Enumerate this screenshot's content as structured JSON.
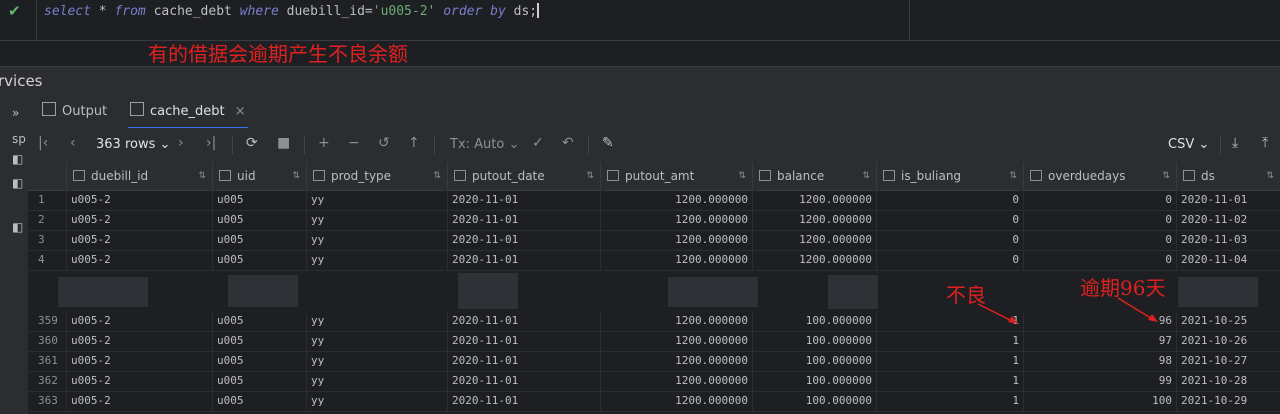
{
  "editor": {
    "sql": {
      "kw_select": "select",
      "star": " * ",
      "kw_from": "from",
      "table": " cache_debt ",
      "kw_where": "where",
      "cond": " duebill_id=",
      "val": "'u005-2'",
      "kw_order": " order by",
      "tail": " ds;"
    },
    "note": "有的借据会逾期产生不良余额"
  },
  "services": {
    "label": "rvices"
  },
  "left_strip": {
    "label": "sp"
  },
  "tabs": [
    {
      "label": "Output"
    },
    {
      "label": "cache_debt"
    }
  ],
  "toolbar": {
    "rows": "363 rows",
    "tx": "Tx: Auto",
    "export": "CSV"
  },
  "grid": {
    "columns": [
      "duebill_id",
      "uid",
      "prod_type",
      "putout_date",
      "putout_amt",
      "balance",
      "is_buliang",
      "overduedays",
      "ds"
    ],
    "top_rows": [
      {
        "n": "1",
        "duebill_id": "u005-2",
        "uid": "u005",
        "prod_type": "yy",
        "putout_date": "2020-11-01",
        "putout_amt": "1200.000000",
        "balance": "1200.000000",
        "is_buliang": "0",
        "overduedays": "0",
        "ds": "2020-11-01"
      },
      {
        "n": "2",
        "duebill_id": "u005-2",
        "uid": "u005",
        "prod_type": "yy",
        "putout_date": "2020-11-01",
        "putout_amt": "1200.000000",
        "balance": "1200.000000",
        "is_buliang": "0",
        "overduedays": "0",
        "ds": "2020-11-02"
      },
      {
        "n": "3",
        "duebill_id": "u005-2",
        "uid": "u005",
        "prod_type": "yy",
        "putout_date": "2020-11-01",
        "putout_amt": "1200.000000",
        "balance": "1200.000000",
        "is_buliang": "0",
        "overduedays": "0",
        "ds": "2020-11-03"
      },
      {
        "n": "4",
        "duebill_id": "u005-2",
        "uid": "u005",
        "prod_type": "yy",
        "putout_date": "2020-11-01",
        "putout_amt": "1200.000000",
        "balance": "1200.000000",
        "is_buliang": "0",
        "overduedays": "0",
        "ds": "2020-11-04"
      }
    ],
    "bottom_rows": [
      {
        "n": "359",
        "duebill_id": "u005-2",
        "uid": "u005",
        "prod_type": "yy",
        "putout_date": "2020-11-01",
        "putout_amt": "1200.000000",
        "balance": "100.000000",
        "is_buliang": "1",
        "overduedays": "96",
        "ds": "2021-10-25"
      },
      {
        "n": "360",
        "duebill_id": "u005-2",
        "uid": "u005",
        "prod_type": "yy",
        "putout_date": "2020-11-01",
        "putout_amt": "1200.000000",
        "balance": "100.000000",
        "is_buliang": "1",
        "overduedays": "97",
        "ds": "2021-10-26"
      },
      {
        "n": "361",
        "duebill_id": "u005-2",
        "uid": "u005",
        "prod_type": "yy",
        "putout_date": "2020-11-01",
        "putout_amt": "1200.000000",
        "balance": "100.000000",
        "is_buliang": "1",
        "overduedays": "98",
        "ds": "2021-10-27"
      },
      {
        "n": "362",
        "duebill_id": "u005-2",
        "uid": "u005",
        "prod_type": "yy",
        "putout_date": "2020-11-01",
        "putout_amt": "1200.000000",
        "balance": "100.000000",
        "is_buliang": "1",
        "overduedays": "99",
        "ds": "2021-10-28"
      },
      {
        "n": "363",
        "duebill_id": "u005-2",
        "uid": "u005",
        "prod_type": "yy",
        "putout_date": "2020-11-01",
        "putout_amt": "1200.000000",
        "balance": "100.000000",
        "is_buliang": "1",
        "overduedays": "100",
        "ds": "2021-10-29"
      }
    ]
  },
  "annotations": {
    "buliang": "不良",
    "overdue": "逾期96天"
  },
  "colors": {
    "annotation": "#e02020",
    "accent": "#3574f0"
  }
}
